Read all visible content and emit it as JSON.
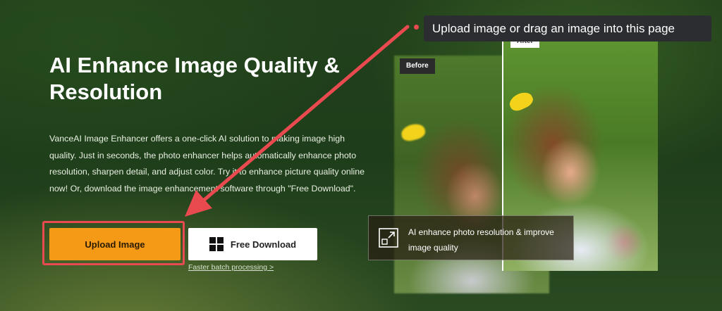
{
  "hero": {
    "title": "AI Enhance Image Quality & Resolution",
    "description": "VanceAI Image Enhancer offers a one-click AI solution to making image high quality. Just in seconds, the photo enhancer helps automatically enhance photo resolution, sharpen detail, and adjust color. Try it to enhance picture quality online now! Or, download the image enhancement software through \"Free Download\"."
  },
  "buttons": {
    "upload_label": "Upload Image",
    "download_label": "Free Download",
    "batch_link": "Faster batch processing >"
  },
  "comparison": {
    "before_label": "Before",
    "after_label": "After",
    "info_text": "AI enhance photo resolution & improve image quality"
  },
  "tooltip": {
    "text": "Upload image or drag an image into this page"
  },
  "colors": {
    "accent": "#f59a17",
    "highlight": "#e84a4f",
    "tooltip_bg": "#2b2d31"
  },
  "icons": {
    "download_button": "windows-icon",
    "info_card": "expand-icon"
  }
}
